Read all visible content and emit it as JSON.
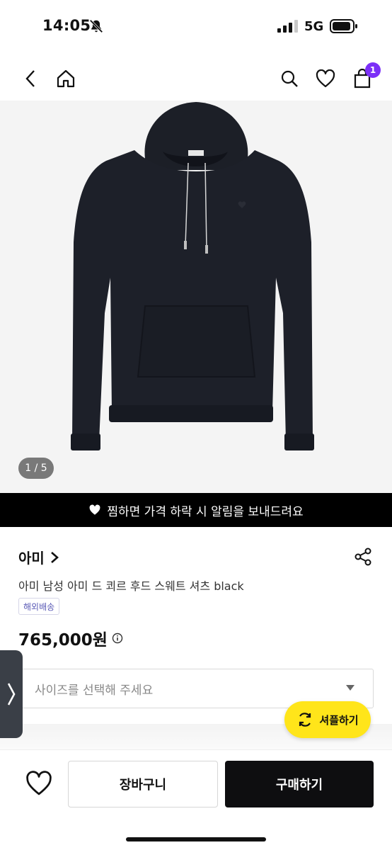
{
  "status": {
    "time": "14:05",
    "network": "5G"
  },
  "nav": {
    "cart_count": "1"
  },
  "gallery": {
    "counter": "1 / 5"
  },
  "alert": {
    "text": "찜하면 가격 하락 시 알림을 보내드려요"
  },
  "product": {
    "brand": "아미",
    "name": "아미 남성 아미 드 쾨르 후드 스웨트 셔츠 black",
    "badge": "해외배송",
    "price": "765,000원"
  },
  "size_select": {
    "placeholder": "사이즈를 선택해 주세요"
  },
  "share_fab": {
    "label": "셔플하기"
  },
  "actions": {
    "cart_label": "장바구니",
    "buy_label": "구매하기"
  },
  "colors": {
    "accent": "#7b2ff7",
    "fab": "#ffe51a",
    "buy": "#0e0e10"
  },
  "icons": [
    "bell-off-icon",
    "signal-icon",
    "battery-icon",
    "back-icon",
    "home-icon",
    "search-icon",
    "heart-icon",
    "shopping-bag-icon",
    "share-icon",
    "info-icon",
    "chevron-right-icon",
    "caret-down-icon",
    "refresh-icon"
  ]
}
